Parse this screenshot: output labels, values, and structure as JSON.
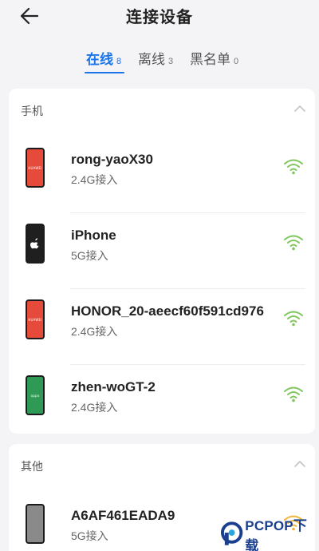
{
  "header": {
    "title": "连接设备"
  },
  "tabs": [
    {
      "label": "在线",
      "count": "8"
    },
    {
      "label": "离线",
      "count": "3"
    },
    {
      "label": "黑名单",
      "count": "0"
    }
  ],
  "sections": {
    "phones": {
      "title": "手机",
      "devices": [
        {
          "name": "rong-yaoX30",
          "connection": "2.4G接入",
          "brand": "HUAWEI",
          "phone_color": "#e64a3b",
          "signal_color": "#7dc65a"
        },
        {
          "name": "iPhone",
          "connection": "5G接入",
          "brand": "apple-icon",
          "phone_color": "#1f1f1f",
          "signal_color": "#7dc65a"
        },
        {
          "name": "HONOR_20-aeecf60f591cd976",
          "connection": "2.4G接入",
          "brand": "HUAWEI",
          "phone_color": "#e64a3b",
          "signal_color": "#7dc65a"
        },
        {
          "name": "zhen-woGT-2",
          "connection": "2.4G接入",
          "brand": "oppo",
          "phone_color": "#2f9a55",
          "signal_color": "#7dc65a"
        }
      ]
    },
    "other": {
      "title": "其他",
      "devices": [
        {
          "name": "A6AF461EADA9",
          "connection": "5G接入",
          "brand": "",
          "phone_color": "#8a8a8a",
          "signal_color": "#f2b233"
        }
      ]
    }
  },
  "watermark": {
    "text": "PCPOP下载"
  },
  "colors": {
    "accent": "#1a73e8",
    "background": "#f4f4f6",
    "card": "#ffffff"
  }
}
